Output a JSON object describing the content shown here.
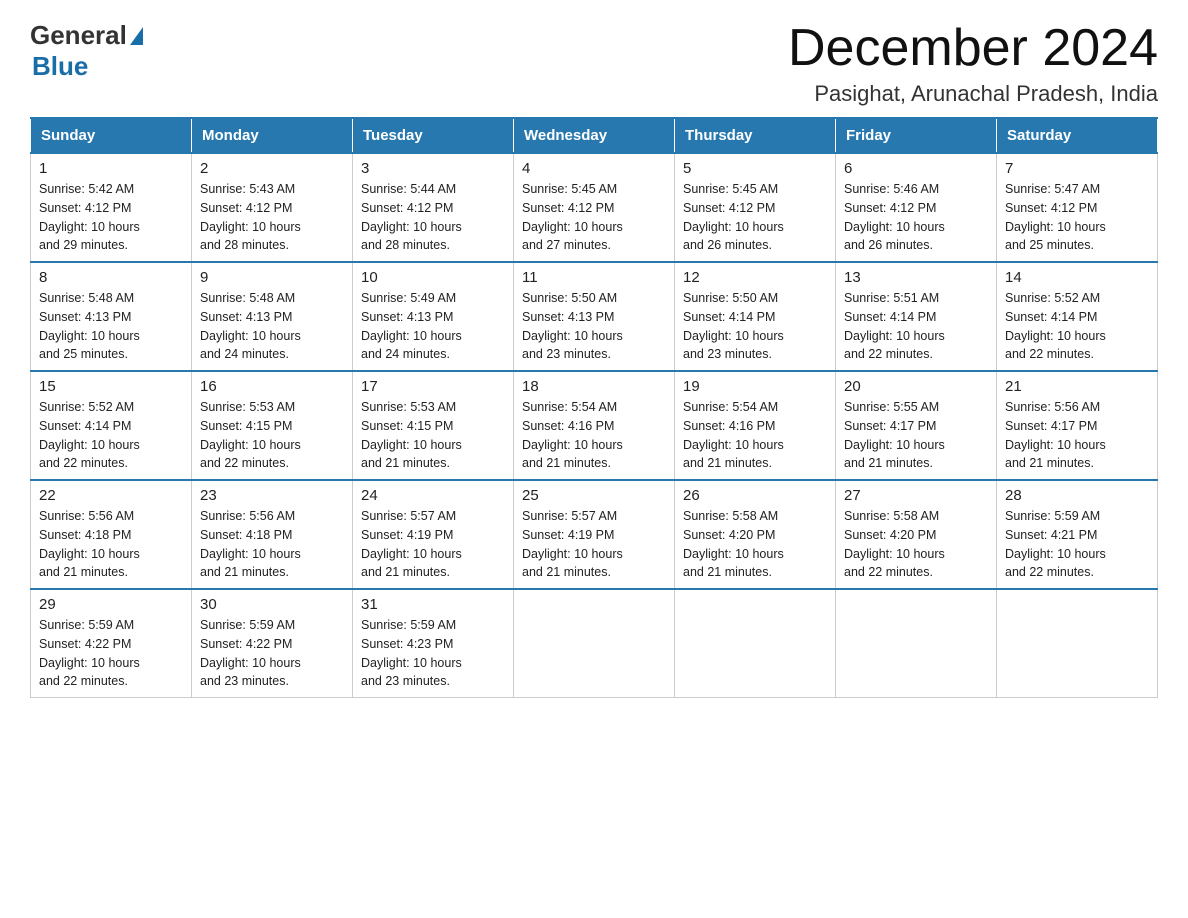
{
  "header": {
    "logo_general": "General",
    "logo_blue": "Blue",
    "title": "December 2024",
    "subtitle": "Pasighat, Arunachal Pradesh, India"
  },
  "days_of_week": [
    "Sunday",
    "Monday",
    "Tuesday",
    "Wednesday",
    "Thursday",
    "Friday",
    "Saturday"
  ],
  "weeks": [
    [
      {
        "day": "1",
        "sunrise": "5:42 AM",
        "sunset": "4:12 PM",
        "daylight": "10 hours and 29 minutes."
      },
      {
        "day": "2",
        "sunrise": "5:43 AM",
        "sunset": "4:12 PM",
        "daylight": "10 hours and 28 minutes."
      },
      {
        "day": "3",
        "sunrise": "5:44 AM",
        "sunset": "4:12 PM",
        "daylight": "10 hours and 28 minutes."
      },
      {
        "day": "4",
        "sunrise": "5:45 AM",
        "sunset": "4:12 PM",
        "daylight": "10 hours and 27 minutes."
      },
      {
        "day": "5",
        "sunrise": "5:45 AM",
        "sunset": "4:12 PM",
        "daylight": "10 hours and 26 minutes."
      },
      {
        "day": "6",
        "sunrise": "5:46 AM",
        "sunset": "4:12 PM",
        "daylight": "10 hours and 26 minutes."
      },
      {
        "day": "7",
        "sunrise": "5:47 AM",
        "sunset": "4:12 PM",
        "daylight": "10 hours and 25 minutes."
      }
    ],
    [
      {
        "day": "8",
        "sunrise": "5:48 AM",
        "sunset": "4:13 PM",
        "daylight": "10 hours and 25 minutes."
      },
      {
        "day": "9",
        "sunrise": "5:48 AM",
        "sunset": "4:13 PM",
        "daylight": "10 hours and 24 minutes."
      },
      {
        "day": "10",
        "sunrise": "5:49 AM",
        "sunset": "4:13 PM",
        "daylight": "10 hours and 24 minutes."
      },
      {
        "day": "11",
        "sunrise": "5:50 AM",
        "sunset": "4:13 PM",
        "daylight": "10 hours and 23 minutes."
      },
      {
        "day": "12",
        "sunrise": "5:50 AM",
        "sunset": "4:14 PM",
        "daylight": "10 hours and 23 minutes."
      },
      {
        "day": "13",
        "sunrise": "5:51 AM",
        "sunset": "4:14 PM",
        "daylight": "10 hours and 22 minutes."
      },
      {
        "day": "14",
        "sunrise": "5:52 AM",
        "sunset": "4:14 PM",
        "daylight": "10 hours and 22 minutes."
      }
    ],
    [
      {
        "day": "15",
        "sunrise": "5:52 AM",
        "sunset": "4:14 PM",
        "daylight": "10 hours and 22 minutes."
      },
      {
        "day": "16",
        "sunrise": "5:53 AM",
        "sunset": "4:15 PM",
        "daylight": "10 hours and 22 minutes."
      },
      {
        "day": "17",
        "sunrise": "5:53 AM",
        "sunset": "4:15 PM",
        "daylight": "10 hours and 21 minutes."
      },
      {
        "day": "18",
        "sunrise": "5:54 AM",
        "sunset": "4:16 PM",
        "daylight": "10 hours and 21 minutes."
      },
      {
        "day": "19",
        "sunrise": "5:54 AM",
        "sunset": "4:16 PM",
        "daylight": "10 hours and 21 minutes."
      },
      {
        "day": "20",
        "sunrise": "5:55 AM",
        "sunset": "4:17 PM",
        "daylight": "10 hours and 21 minutes."
      },
      {
        "day": "21",
        "sunrise": "5:56 AM",
        "sunset": "4:17 PM",
        "daylight": "10 hours and 21 minutes."
      }
    ],
    [
      {
        "day": "22",
        "sunrise": "5:56 AM",
        "sunset": "4:18 PM",
        "daylight": "10 hours and 21 minutes."
      },
      {
        "day": "23",
        "sunrise": "5:56 AM",
        "sunset": "4:18 PM",
        "daylight": "10 hours and 21 minutes."
      },
      {
        "day": "24",
        "sunrise": "5:57 AM",
        "sunset": "4:19 PM",
        "daylight": "10 hours and 21 minutes."
      },
      {
        "day": "25",
        "sunrise": "5:57 AM",
        "sunset": "4:19 PM",
        "daylight": "10 hours and 21 minutes."
      },
      {
        "day": "26",
        "sunrise": "5:58 AM",
        "sunset": "4:20 PM",
        "daylight": "10 hours and 21 minutes."
      },
      {
        "day": "27",
        "sunrise": "5:58 AM",
        "sunset": "4:20 PM",
        "daylight": "10 hours and 22 minutes."
      },
      {
        "day": "28",
        "sunrise": "5:59 AM",
        "sunset": "4:21 PM",
        "daylight": "10 hours and 22 minutes."
      }
    ],
    [
      {
        "day": "29",
        "sunrise": "5:59 AM",
        "sunset": "4:22 PM",
        "daylight": "10 hours and 22 minutes."
      },
      {
        "day": "30",
        "sunrise": "5:59 AM",
        "sunset": "4:22 PM",
        "daylight": "10 hours and 23 minutes."
      },
      {
        "day": "31",
        "sunrise": "5:59 AM",
        "sunset": "4:23 PM",
        "daylight": "10 hours and 23 minutes."
      },
      null,
      null,
      null,
      null
    ]
  ],
  "labels": {
    "sunrise": "Sunrise: ",
    "sunset": "Sunset: ",
    "daylight": "Daylight: "
  }
}
